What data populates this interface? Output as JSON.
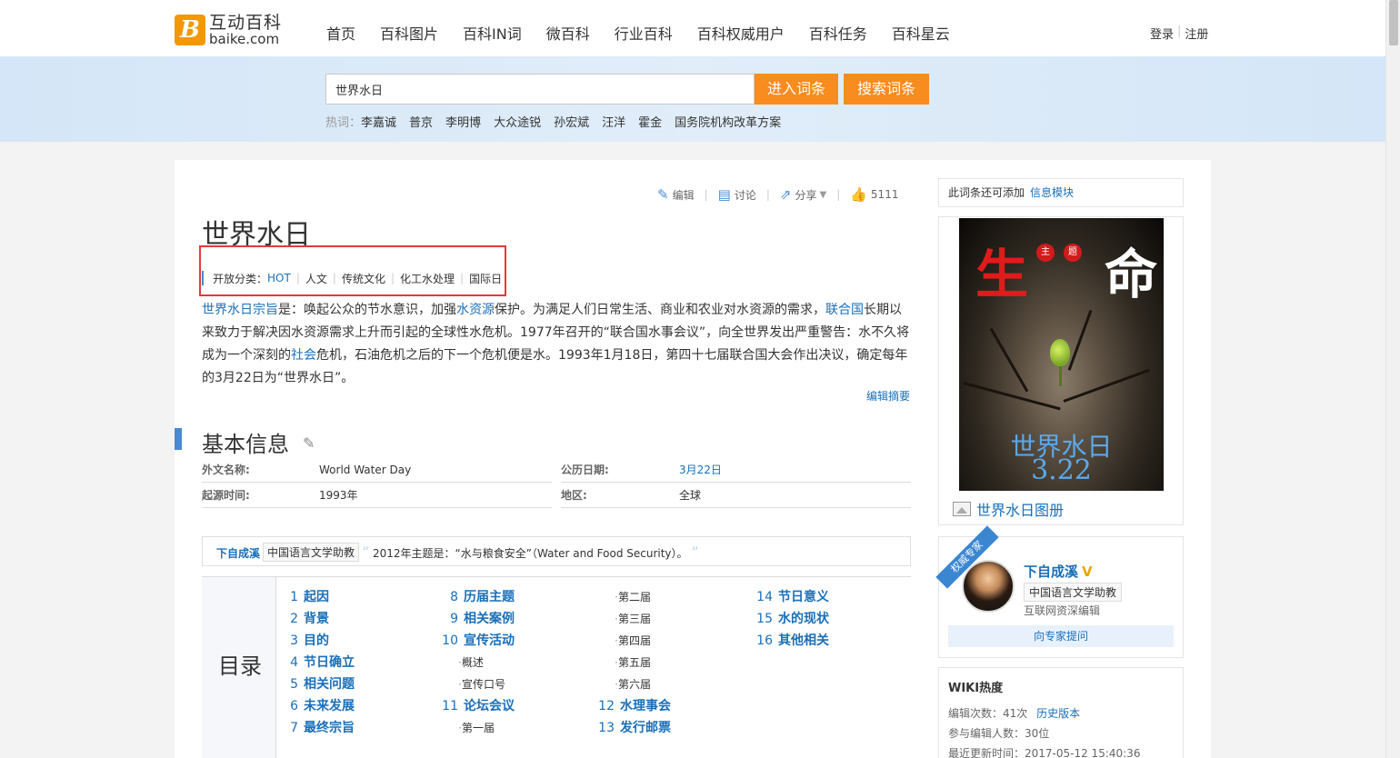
{
  "header": {
    "logo_cn": "互动百科",
    "logo_en": "baike.com",
    "logo_mark": "B",
    "nav": [
      "首页",
      "百科图片",
      "百科IN词",
      "微百科",
      "行业百科",
      "百科权威用户",
      "百科任务",
      "百科星云"
    ],
    "login": "登录",
    "register": "注册"
  },
  "search": {
    "value": "世界水日",
    "enter_label": "进入词条",
    "search_label": "搜索词条",
    "hot_label": "热词：",
    "hot_words": [
      "李嘉诚",
      "普京",
      "李明博",
      "大众途锐",
      "孙宏斌",
      "汪洋",
      "霍金",
      "国务院机构改革方案"
    ]
  },
  "toolbar": {
    "edit": "编辑",
    "discuss": "讨论",
    "share": "分享",
    "likes": "5111"
  },
  "article": {
    "title": "世界水日",
    "category_label": "开放分类：",
    "categories": [
      "HOT",
      "人文",
      "传统文化",
      "化工水处理",
      "国际日"
    ],
    "summary": {
      "link1": "世界水日宗旨",
      "t1": "是：唤起公众的节水意识，加强",
      "link2": "水资源",
      "t2": "保护。为满足人们日常生活、商业和农业对水资源的需求，",
      "link3": "联合国",
      "t3": "长期以来致力于解决因水资源需求上升而引起的全球性水危机。1977年召开的“联合国水事会议”，向全世界发出严重警告：水不久将成为一个深刻的",
      "link4": "社会",
      "t4": "危机，石油危机之后的下一个危机便是水。1993年1月18日，第四十七届联合国大会作出决议，确定每年的3月22日为“世界水日”。"
    },
    "edit_summary": "编辑摘要",
    "section_title": "基本信息",
    "info": {
      "foreign_name_key": "外文名称:",
      "foreign_name_val": "World Water Day",
      "calendar_key": "公历日期:",
      "calendar_val": "3月22日",
      "origin_key": "起源时间:",
      "origin_val": "1993年",
      "region_key": "地区:",
      "region_val": "全球"
    },
    "quote": {
      "author": "下自成溪",
      "badge": "中国语言文学助教",
      "text": "2012年主题是：“水与粮食安全”（Water and Food Security）。"
    }
  },
  "toc": {
    "label": "目录",
    "col1": [
      {
        "num": "1",
        "text": "起因"
      },
      {
        "num": "2",
        "text": "背景"
      },
      {
        "num": "3",
        "text": "目的"
      },
      {
        "num": "4",
        "text": "节日确立"
      },
      {
        "num": "5",
        "text": "相关问题"
      },
      {
        "num": "6",
        "text": "未来发展"
      },
      {
        "num": "7",
        "text": "最终宗旨"
      }
    ],
    "col2": [
      {
        "num": "8",
        "text": "历届主题"
      },
      {
        "num": "9",
        "text": "相关案例"
      },
      {
        "num": "10",
        "text": "宣传活动"
      },
      {
        "sub": "概述"
      },
      {
        "sub": "宣传口号"
      },
      {
        "num": "11",
        "text": "论坛会议"
      },
      {
        "sub": "第一届"
      }
    ],
    "col3": [
      {
        "sub": "第二届"
      },
      {
        "sub": "第三届"
      },
      {
        "sub": "第四届"
      },
      {
        "sub": "第五届"
      },
      {
        "sub": "第六届"
      },
      {
        "num": "12",
        "text": "水理事会"
      },
      {
        "num": "13",
        "text": "发行邮票"
      }
    ],
    "col4": [
      {
        "num": "14",
        "text": "节日意义"
      },
      {
        "num": "15",
        "text": "水的现状"
      },
      {
        "num": "16",
        "text": "其他相关"
      }
    ]
  },
  "sidebar": {
    "add_module_text": "此词条还可添加",
    "add_module_link": "信息模块",
    "poster_char_left": "生",
    "poster_char_right": "命",
    "poster_dot1": "主",
    "poster_dot2": "题",
    "poster_title": "世界水日",
    "poster_date": "3.22",
    "album_link": "世界水日图册",
    "expert": {
      "ribbon": "权威专家",
      "name": "下自成溪",
      "v": "V",
      "badge": "中国语言文学助教",
      "role": "互联网资深编辑",
      "ask": "向专家提问"
    },
    "wiki": {
      "title": "WIKI热度",
      "edit_count": "编辑次数：41次",
      "history": "历史版本",
      "editors": "参与编辑人数：30位",
      "last_update": "最近更新时间：2017-05-12 15:40:36"
    }
  },
  "colors": {
    "accent_orange": "#f88c1e",
    "link_blue": "#1a6fb9",
    "highlight_red": "#e4393c"
  }
}
